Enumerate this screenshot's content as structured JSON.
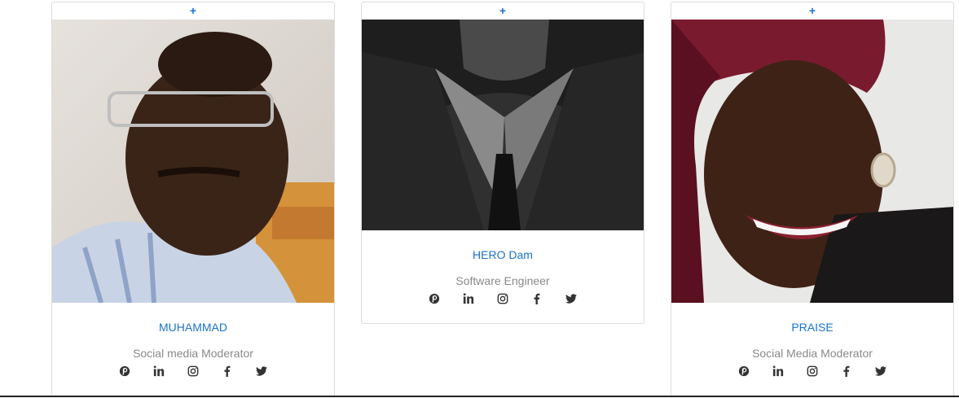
{
  "cards": [
    {
      "plus": "+",
      "name": "MUHAMMAD",
      "role": "Social media Moderator"
    },
    {
      "plus": "+",
      "name": "HERO Dam",
      "role": "Software Engineer"
    },
    {
      "plus": "+",
      "name": "PRAISE",
      "role": "Social Media Moderator"
    }
  ],
  "social_icons": [
    "pinterest-icon",
    "linkedin-icon",
    "instagram-icon",
    "facebook-icon",
    "twitter-icon"
  ],
  "colors": {
    "accent": "#1a73c8",
    "muted": "#8a8a8a"
  }
}
